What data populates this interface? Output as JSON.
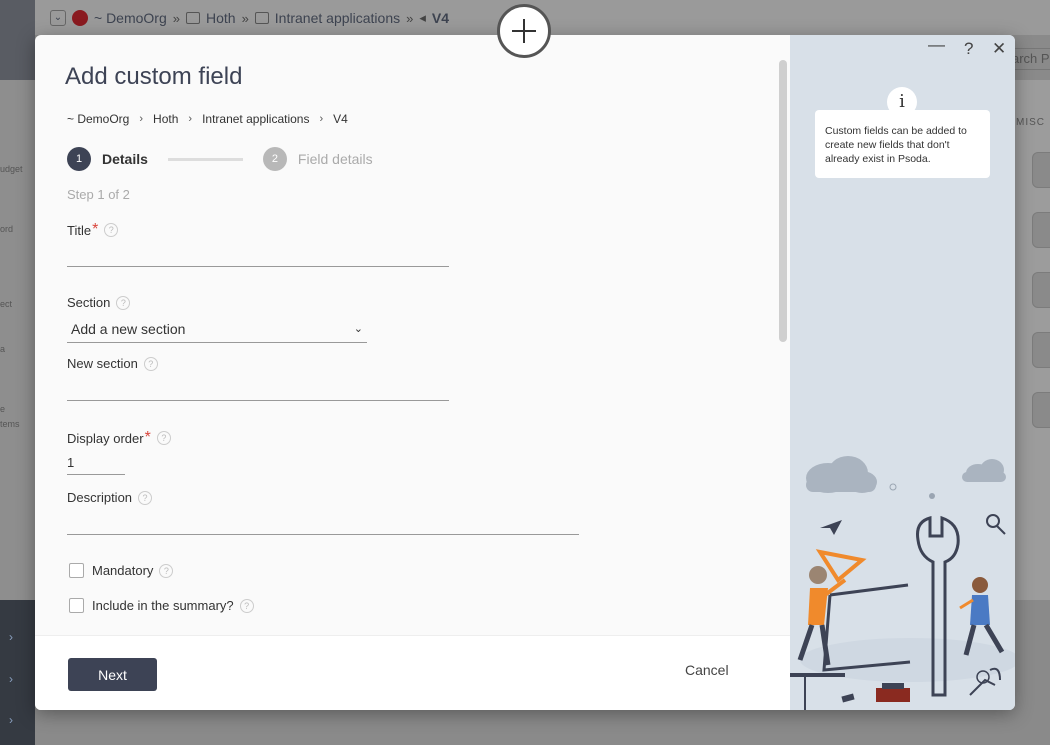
{
  "background": {
    "breadcrumb": [
      "~ DemoOrg",
      "Hoth",
      "Intranet applications",
      "V4"
    ],
    "search_placeholder": "arch P",
    "misc_label": "MISC",
    "side_fragments": [
      "udget",
      "ord",
      "ect",
      "a",
      "e",
      "tems"
    ]
  },
  "modal": {
    "title": "Add custom field",
    "breadcrumb": [
      "~ DemoOrg",
      "Hoth",
      "Intranet applications",
      "V4"
    ],
    "steps": [
      {
        "number": "1",
        "label": "Details"
      },
      {
        "number": "2",
        "label": "Field details"
      }
    ],
    "step_progress": "Step 1 of 2",
    "fields": {
      "title_label": "Title",
      "section_label": "Section",
      "section_value": "Add a new section",
      "new_section_label": "New section",
      "display_order_label": "Display order",
      "display_order_value": "1",
      "description_label": "Description",
      "mandatory_label": "Mandatory",
      "summary_label": "Include in the summary?"
    },
    "footer": {
      "next_label": "Next",
      "cancel_label": "Cancel"
    },
    "side": {
      "tip_text": "Custom fields can be added to create new fields that don't already exist in Psoda.",
      "info_glyph": "i",
      "minimize_glyph": "—",
      "help_glyph": "?",
      "close_glyph": "✕"
    }
  },
  "icons": {
    "required_marker": "*",
    "help_marker": "?"
  }
}
